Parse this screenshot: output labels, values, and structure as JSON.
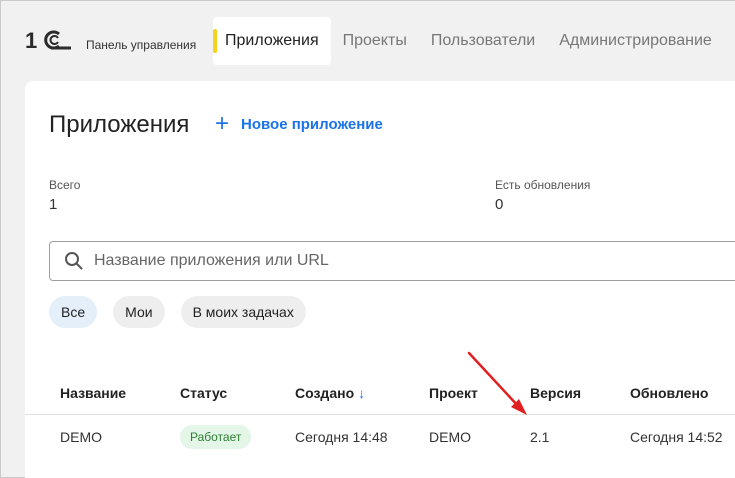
{
  "header": {
    "logo_text": "1С",
    "panel_title": "Панель управления",
    "nav": [
      {
        "label": "Приложения",
        "active": true
      },
      {
        "label": "Проекты",
        "active": false
      },
      {
        "label": "Пользователи",
        "active": false
      },
      {
        "label": "Администрирование",
        "active": false
      }
    ]
  },
  "main": {
    "title": "Приложения",
    "new_app_label": "Новое приложение",
    "stats": [
      {
        "label": "Всего",
        "value": "1"
      },
      {
        "label": "Есть обновления",
        "value": "0"
      }
    ],
    "search": {
      "placeholder": "Название приложения или URL",
      "value": ""
    },
    "filters": [
      {
        "label": "Все",
        "active": true
      },
      {
        "label": "Мои",
        "active": false
      },
      {
        "label": "В моих задачах",
        "active": false
      }
    ],
    "table": {
      "columns": [
        "Название",
        "Статус",
        "Создано",
        "Проект",
        "Версия",
        "Обновлено"
      ],
      "sort_indicator": "↓",
      "rows": [
        {
          "name": "DEMO",
          "status": "Работает",
          "created": "Сегодня 14:48",
          "project": "DEMO",
          "version": "2.1",
          "updated": "Сегодня 14:52"
        }
      ]
    }
  },
  "colors": {
    "accent": "#1a73e8",
    "nav_marker": "#f6d21c",
    "status_ok_bg": "#e3f6e8",
    "status_ok_text": "#2e7d32",
    "annotation_arrow": "#e02020",
    "logo": "#2b2b2b"
  },
  "icons": [
    "logo-1c",
    "plus-icon",
    "search-icon",
    "sort-down-icon",
    "annotation-arrow"
  ]
}
